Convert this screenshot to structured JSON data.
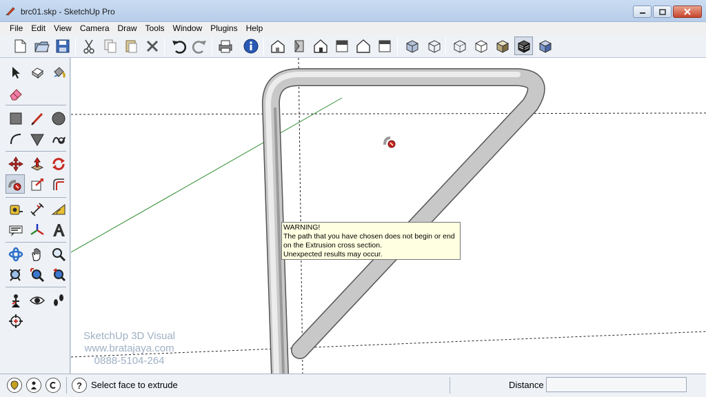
{
  "window": {
    "title": "brc01.skp - SketchUp Pro"
  },
  "menu": [
    "File",
    "Edit",
    "View",
    "Camera",
    "Draw",
    "Tools",
    "Window",
    "Plugins",
    "Help"
  ],
  "toolbar_icons": [
    "new-file-icon",
    "open-file-icon",
    "save-icon",
    "cut-icon",
    "copy-icon",
    "paste-icon",
    "erase-icon",
    "undo-icon",
    "redo-icon",
    "print-icon",
    "model-info-icon",
    "iso-view-icon",
    "top-view-icon",
    "front-view-icon",
    "right-view-icon",
    "back-view-icon",
    "left-view-icon",
    "xray-style-icon",
    "wireframe-style-icon",
    "hidden-line-style-icon",
    "shaded-style-icon",
    "shaded-textures-style-icon",
    "monochrome-style-icon"
  ],
  "palette_icons": [
    "select-icon",
    "make-component-icon",
    "paint-bucket-icon",
    "eraser-icon",
    "rectangle-icon",
    "line-icon",
    "circle-icon",
    "arc-icon",
    "polygon-icon",
    "freehand-icon",
    "move-icon",
    "push-pull-icon",
    "rotate-icon",
    "follow-me-icon",
    "scale-icon",
    "offset-icon",
    "tape-measure-icon",
    "dimension-icon",
    "protractor-icon",
    "text-icon",
    "axes-icon",
    "3d-text-icon",
    "orbit-icon",
    "pan-icon",
    "zoom-icon",
    "zoom-window-icon",
    "zoom-extents-icon",
    "previous-view-icon",
    "position-camera-icon",
    "look-around-icon",
    "walk-icon",
    "section-plane-icon"
  ],
  "tooltip": {
    "title": "WARNING!",
    "line1": "The path that you have chosen does not begin or end",
    "line2": "on the Extrusion cross section.",
    "line3": "Unexpected results may occur."
  },
  "watermark": {
    "line1": "SketchUp 3D Visual",
    "line2": "www.bratajaya.com",
    "line3": "0888-5104-264"
  },
  "status": {
    "icons": [
      "geo-location-icon",
      "credits-icon",
      "copyright-icon",
      "help-icon"
    ],
    "text": "Select face to extrude",
    "measurement_label": "Distance",
    "measurement_value": ""
  },
  "colors": {
    "accent": "#3b6fb6",
    "green_axis": "#2e8b2e",
    "tooltip_bg": "#ffffe1"
  }
}
